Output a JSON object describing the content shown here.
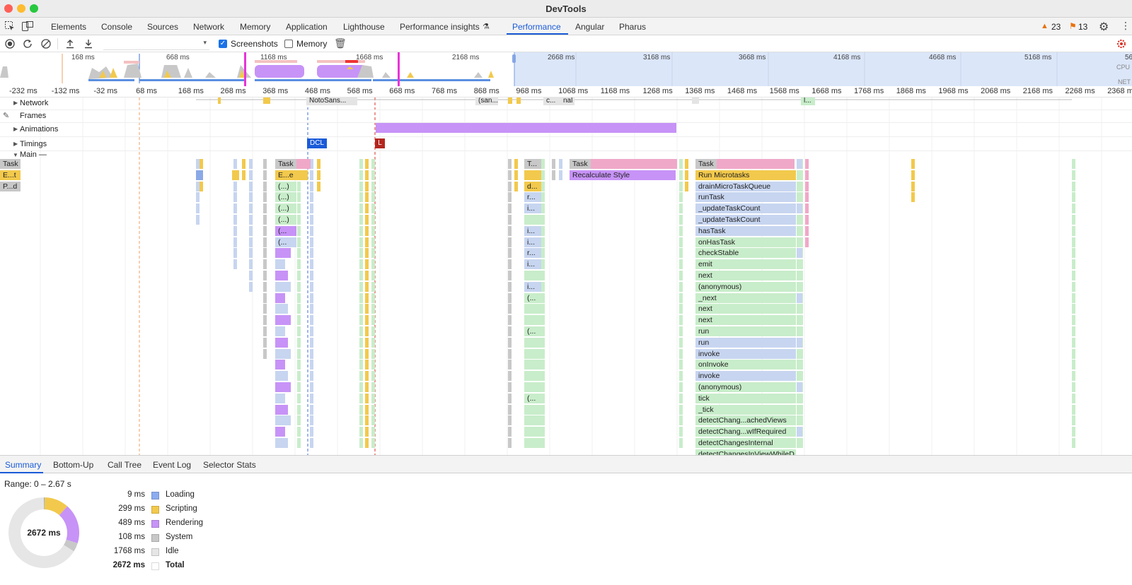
{
  "window": {
    "title": "DevTools"
  },
  "tabs": [
    "Elements",
    "Console",
    "Sources",
    "Network",
    "Memory",
    "Application",
    "Lighthouse",
    "Performance insights",
    "Performance",
    "Angular",
    "Pharus"
  ],
  "active_tab": "Performance",
  "status": {
    "warnings": "23",
    "issues": "13"
  },
  "toolbar": {
    "screenshots_label": "Screenshots",
    "memory_label": "Memory",
    "screenshots_checked": true,
    "memory_checked": false
  },
  "overview_ticks": [
    "168 ms",
    "668 ms",
    "1168 ms",
    "1668 ms",
    "2168 ms",
    "2668 ms",
    "3168 ms",
    "3668 ms",
    "4168 ms",
    "4668 ms",
    "5168 ms",
    "56"
  ],
  "overview_side_labels": {
    "cpu": "CPU",
    "net": "NET"
  },
  "ruler_ticks": [
    "-232 ms",
    "-132 ms",
    "-32 ms",
    "68 ms",
    "168 ms",
    "268 ms",
    "368 ms",
    "468 ms",
    "568 ms",
    "668 ms",
    "768 ms",
    "868 ms",
    "968 ms",
    "1068 ms",
    "1168 ms",
    "1268 ms",
    "1368 ms",
    "1468 ms",
    "1568 ms",
    "1668 ms",
    "1768 ms",
    "1868 ms",
    "1968 ms",
    "2068 ms",
    "2168 ms",
    "2268 ms",
    "2368 m"
  ],
  "tracks": {
    "network": "Network",
    "frames": "Frames",
    "animations": "Animations",
    "timings": "Timings",
    "main": "Main —",
    "network_items": [
      "NotoSans...",
      "(san...",
      "c...",
      "nal",
      "l..."
    ],
    "timing_markers": {
      "dcl": "DCL",
      "l": "L"
    }
  },
  "flame": {
    "left_col": [
      "Task",
      "E...t",
      "P...d"
    ],
    "col_a": [
      "Task",
      "E...e",
      "(...)",
      "(...)",
      "(...)",
      "(...)",
      "(...",
      "(..."
    ],
    "col_b": [
      "T...",
      "",
      "d...",
      "r...",
      "i...",
      "",
      "i...",
      "i...",
      "r...",
      "i...",
      "",
      "i...",
      "(...",
      "",
      "",
      "(...",
      "",
      "",
      "",
      "",
      "",
      "(..."
    ],
    "col_c": [
      "Task",
      "Recalculate Style"
    ],
    "col_d": [
      "Task",
      "Run Microtasks",
      "drainMicroTaskQueue",
      "runTask",
      "_updateTaskCount",
      "_updateTaskCount",
      "hasTask",
      "onHasTask",
      "checkStable",
      "emit",
      "next",
      "(anonymous)",
      "_next",
      "next",
      "next",
      "run",
      "run",
      "invoke",
      "onInvoke",
      "invoke",
      "(anonymous)",
      "tick",
      "_tick",
      "detectChang...achedViews",
      "detectChang...wIfRequired",
      "detectChangesInternal",
      "detectChangesInViewWhileD..."
    ]
  },
  "bottom_tabs": [
    "Summary",
    "Bottom-Up",
    "Call Tree",
    "Event Log",
    "Selector Stats"
  ],
  "active_bottom_tab": "Summary",
  "summary": {
    "range": "Range: 0 – 2.67 s",
    "total_center": "2672 ms",
    "rows": [
      {
        "value": "9 ms",
        "name": "Loading",
        "color": "#8cabf0",
        "ms": 9
      },
      {
        "value": "299 ms",
        "name": "Scripting",
        "color": "#f2c94c",
        "ms": 299
      },
      {
        "value": "489 ms",
        "name": "Rendering",
        "color": "#c793f7",
        "ms": 489
      },
      {
        "value": "108 ms",
        "name": "System",
        "color": "#c8c8c8",
        "ms": 108
      },
      {
        "value": "1768 ms",
        "name": "Idle",
        "color": "#e6e6e6",
        "ms": 1768
      },
      {
        "value": "2672 ms",
        "name": "Total",
        "color": "#ffffff",
        "ms": 0
      }
    ]
  }
}
